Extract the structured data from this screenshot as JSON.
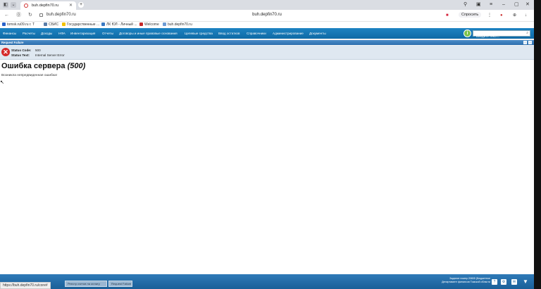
{
  "browser": {
    "tab_title": "buh.depfin70.ru",
    "url": "buh.depfin70.ru",
    "center_title": "buh.depfin70.ru",
    "ask_label": "Спросить",
    "status_url": "https://buh.depfin70.ru/core#"
  },
  "bookmarks": [
    {
      "label": "tomsk.ru09.ru г. Т",
      "color": "#2a62c9"
    },
    {
      "label": "СБИС",
      "color": "#5a7da8"
    },
    {
      "label": "Государственные ...",
      "color": "#f2c200"
    },
    {
      "label": "ЛК ЮЛ - Личный ...",
      "color": "#3a79c2"
    },
    {
      "label": "Welcome",
      "color": "#c62828"
    },
    {
      "label": "buh.depfin70.ru",
      "color": "#6d9bd4"
    }
  ],
  "menu": {
    "items": [
      "Финансы",
      "Расчеты",
      "Доходы",
      "НФА",
      "Инвентаризация",
      "Отчеты",
      "Договоры и иные правовые основания",
      "Целевые средства",
      "Ввод остатков",
      "Справочники",
      "Администрирование",
      "Документы"
    ],
    "search_placeholder": "Введите текст..."
  },
  "panel": {
    "title": "Request Failure",
    "status_code_label": "Status Code:",
    "status_code": "500",
    "status_text_label": "Status Text:",
    "status_text": "Internal Server Error"
  },
  "error": {
    "heading": "Ошибка сервера",
    "code": "(500)",
    "message": "Возникла непредвиденная ошибка!"
  },
  "taskbar": {
    "tabs": [
      "Реестр счетов на оплату",
      "Request Failure"
    ],
    "org_line1": "Задание номер 20805 (Бюджетное",
    "org_line2": "Департамент финансов Томской области"
  }
}
